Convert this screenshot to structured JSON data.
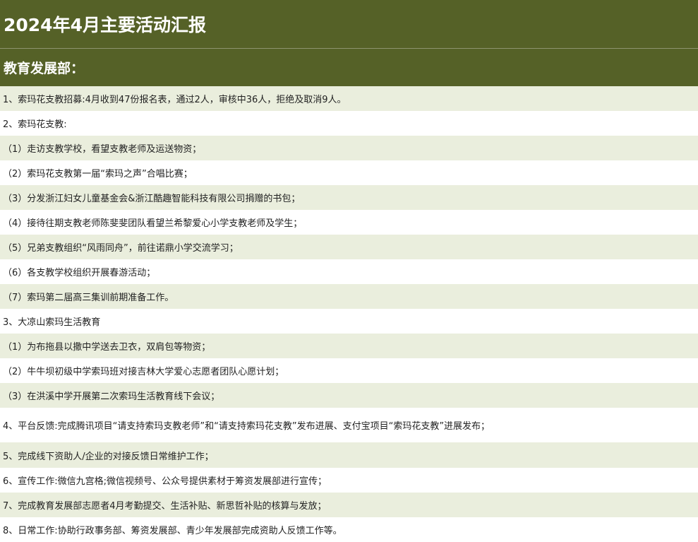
{
  "page": {
    "title": "2024年4月主要活动汇报",
    "section_title": "教育发展部：",
    "colors": {
      "header_bg": "#556127",
      "row_shade": "#eaeedd",
      "row_plain": "#ffffff",
      "text": "#222222"
    }
  },
  "items": [
    "1、索玛花支教招募:4月收到47份报名表，通过2人，审核中36人，拒绝及取消9人。",
    "2、索玛花支教:",
    "（1）走访支教学校，看望支教老师及运送物资；",
    "（2）索玛花支教第一届“索玛之声”合唱比赛；",
    "（3）分发浙江妇女儿童基金会&浙江酷趣智能科技有限公司捐赠的书包；",
    "（4）接待往期支教老师陈斐斐团队看望兰希黎爱心小学支教老师及学生；",
    "（5）兄弟支教组织“风雨同舟”，前往诺鼎小学交流学习；",
    "（6）各支教学校组织开展春游活动；",
    "（7）索玛第二届高三集训前期准备工作。",
    "3、大凉山索玛生活教育",
    "（1）为布拖县以撒中学送去卫衣，双肩包等物资；",
    "（2）牛牛坝初级中学索玛班对接吉林大学爱心志愿者团队心愿计划；",
    "（3）在洪溪中学开展第二次索玛生活教育线下会议；",
    "4、平台反馈:完成腾讯项目“请支持索玛支教老师”和“请支持索玛花支教”发布进展、支付宝项目“索玛花支教”进展发布；",
    "5、完成线下资助人/企业的对接反馈日常维护工作；",
    "6、宣传工作:微信九宫格;微信视频号、公众号提供素材于筹资发展部进行宣传；",
    "7、完成教育发展部志愿者4月考勤提交、生活补贴、新思哲补贴的核算与发放；",
    "8、日常工作:协助行政事务部、筹资发展部、青少年发展部完成资助人反馈工作等。"
  ]
}
